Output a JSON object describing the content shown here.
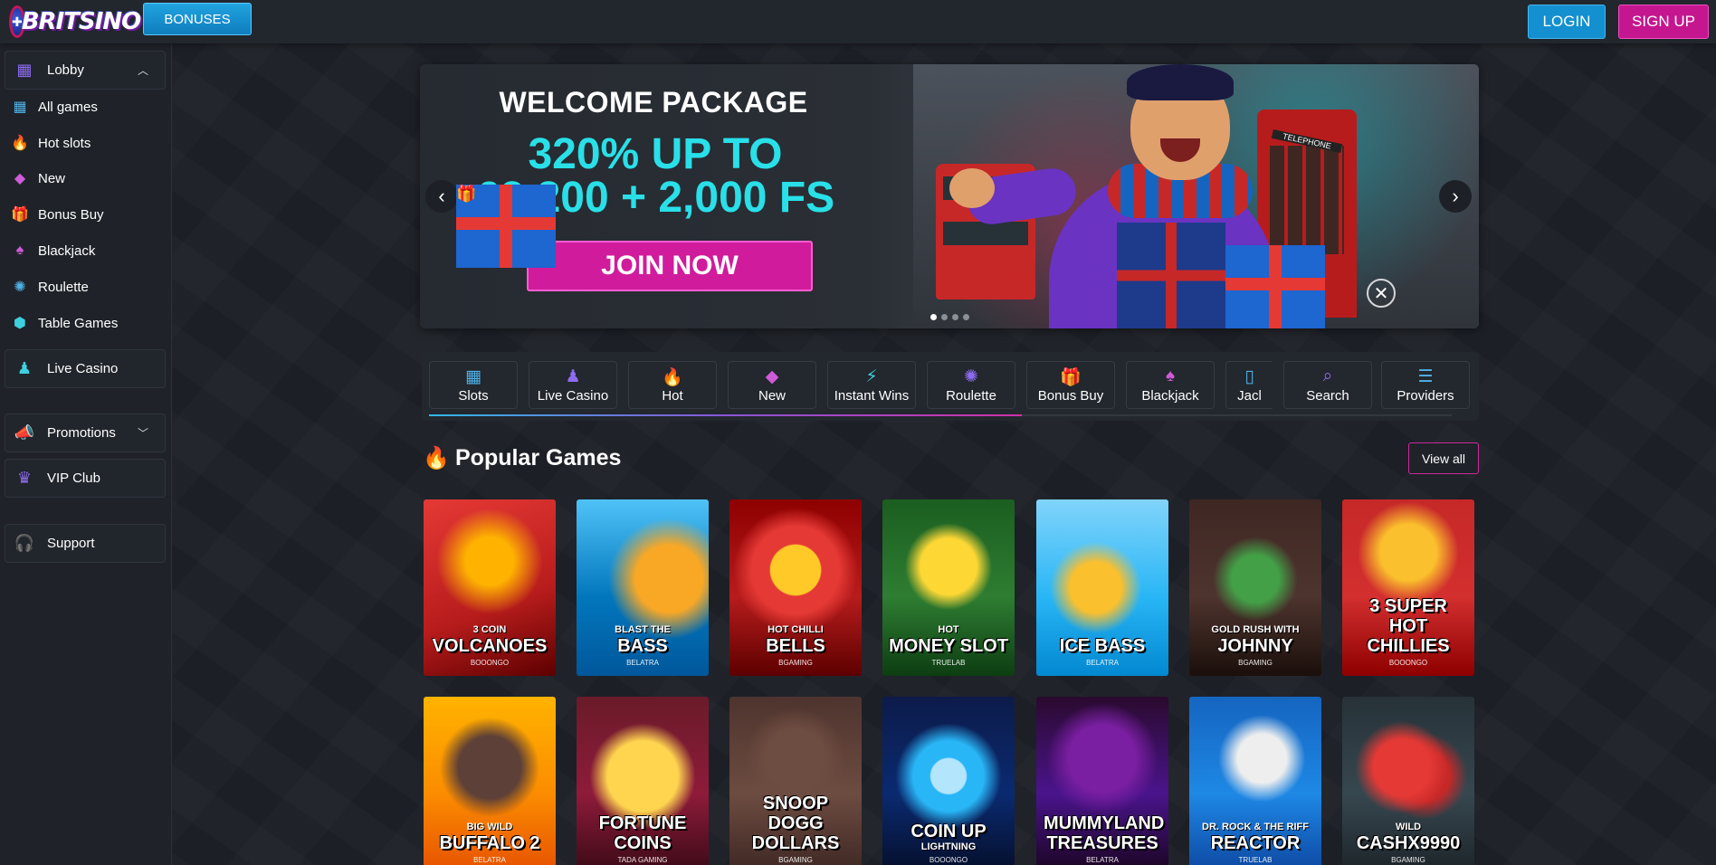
{
  "header": {
    "logo_text": "BRITSINO",
    "bonuses_label": "BONUSES",
    "login_label": "LOGIN",
    "signup_label": "SIGN UP"
  },
  "sidebar": {
    "lobby": "Lobby",
    "items": [
      {
        "label": "All games",
        "icon": "grid-icon"
      },
      {
        "label": "Hot slots",
        "icon": "flame-icon"
      },
      {
        "label": "New",
        "icon": "diamond-icon"
      },
      {
        "label": "Bonus Buy",
        "icon": "gift-icon"
      },
      {
        "label": "Blackjack",
        "icon": "cards-icon"
      },
      {
        "label": "Roulette",
        "icon": "roulette-icon"
      },
      {
        "label": "Table Games",
        "icon": "cube-icon"
      }
    ],
    "live_casino": "Live Casino",
    "promotions": "Promotions",
    "vip_club": "VIP Club",
    "support": "Support"
  },
  "banner": {
    "heading": "WELCOME PACKAGE",
    "offer_line1": "320% UP TO",
    "offer_line2": "£2,200 + 2,000 FS",
    "cta": "JOIN NOW",
    "booth_label": "TELEPHONE",
    "prev": "‹",
    "next": "›",
    "slides": 4,
    "active_slide": 1
  },
  "categories": [
    {
      "label": "Slots",
      "icon": "grid-icon"
    },
    {
      "label": "Live Casino",
      "icon": "dealer-icon"
    },
    {
      "label": "Hot",
      "icon": "flame-icon"
    },
    {
      "label": "New",
      "icon": "diamond-icon"
    },
    {
      "label": "Instant Wins",
      "icon": "lightning-icon"
    },
    {
      "label": "Roulette",
      "icon": "roulette-icon"
    },
    {
      "label": "Bonus Buy",
      "icon": "gift-icon"
    },
    {
      "label": "Blackjack",
      "icon": "cards-icon"
    },
    {
      "label": "Jacl",
      "icon": "phone-icon"
    },
    {
      "label": "Search",
      "icon": "search-icon"
    },
    {
      "label": "Providers",
      "icon": "sliders-icon"
    }
  ],
  "category_scroll_progress": 0.58,
  "popular": {
    "title": "Popular Games",
    "view_all": "View all"
  },
  "games_row1": [
    {
      "sub": "3 COIN",
      "big": "VOLCANOES",
      "prov": "BOOONGO"
    },
    {
      "sub": "BLAST THE",
      "big": "BASS",
      "prov": "BELATRA"
    },
    {
      "sub": "HOT CHILLI",
      "big": "BELLS",
      "prov": "BGAMING"
    },
    {
      "sub": "HOT",
      "big": "MONEY SLOT",
      "prov": "TRUELAB"
    },
    {
      "sub": "",
      "big": "ICE BASS",
      "prov": "BELATRA"
    },
    {
      "sub": "GOLD RUSH WITH",
      "big": "JOHNNY",
      "prov": "BGAMING"
    },
    {
      "sub": "",
      "big": "3 SUPER HOT CHILLIES",
      "prov": "BOOONGO"
    }
  ],
  "games_row2": [
    {
      "sub": "BIG WILD",
      "big": "BUFFALO 2",
      "prov": "BELATRA"
    },
    {
      "sub": "",
      "big": "FORTUNE COINS",
      "prov": "TADA GAMING"
    },
    {
      "sub": "",
      "big": "SNOOP DOGG DOLLARS",
      "prov": "BGAMING"
    },
    {
      "sub": "",
      "big": "COIN UP",
      "prov": "BOOONGO",
      "sub2": "LIGHTNING"
    },
    {
      "sub": "",
      "big": "MUMMYLAND TREASURES",
      "prov": "BELATRA"
    },
    {
      "sub": "DR. ROCK & THE RIFF",
      "big": "REACTOR",
      "prov": "TRUELAB"
    },
    {
      "sub": "WILD",
      "big": "CASHX9990",
      "prov": "BGAMING"
    }
  ],
  "colors": {
    "accent_blue": "#1490d0",
    "accent_pink": "#c4178f",
    "offer_cyan": "#29e0e8"
  }
}
